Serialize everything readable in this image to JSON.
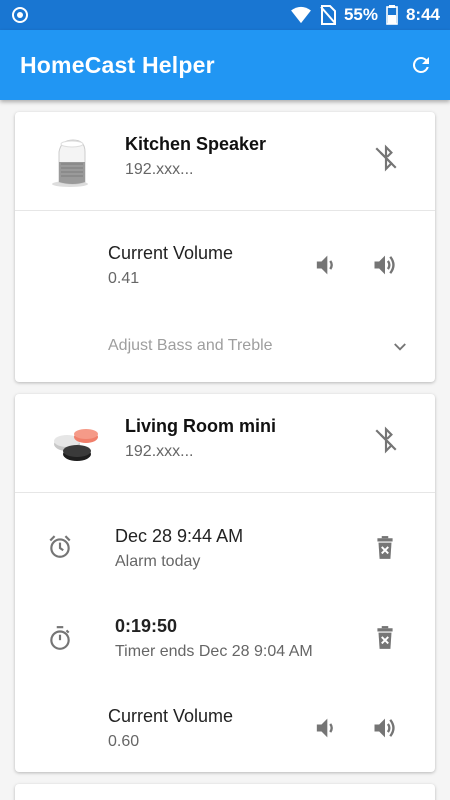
{
  "status_bar": {
    "battery": "55%",
    "time": "8:44"
  },
  "app_bar": {
    "title": "HomeCast Helper",
    "refresh_icon": "refresh-icon"
  },
  "devices": [
    {
      "name": "Kitchen Speaker",
      "ip": "192.xxx...",
      "image": "google-home-speaker",
      "volume_label": "Current Volume",
      "volume_value": "0.41",
      "adjust_label": "Adjust Bass and Treble"
    },
    {
      "name": "Living Room mini",
      "ip": "192.xxx...",
      "image": "google-home-mini-speakers",
      "alarm": {
        "time": "Dec 28 9:44 AM",
        "desc": "Alarm today"
      },
      "timer": {
        "time": "0:19:50",
        "desc": "Timer ends Dec 28 9:04 AM"
      },
      "volume_label": "Current Volume",
      "volume_value": "0.60"
    }
  ],
  "colors": {
    "status_bar": "#1976d2",
    "app_bar": "#2196f3",
    "icon_grey": "#757575"
  }
}
